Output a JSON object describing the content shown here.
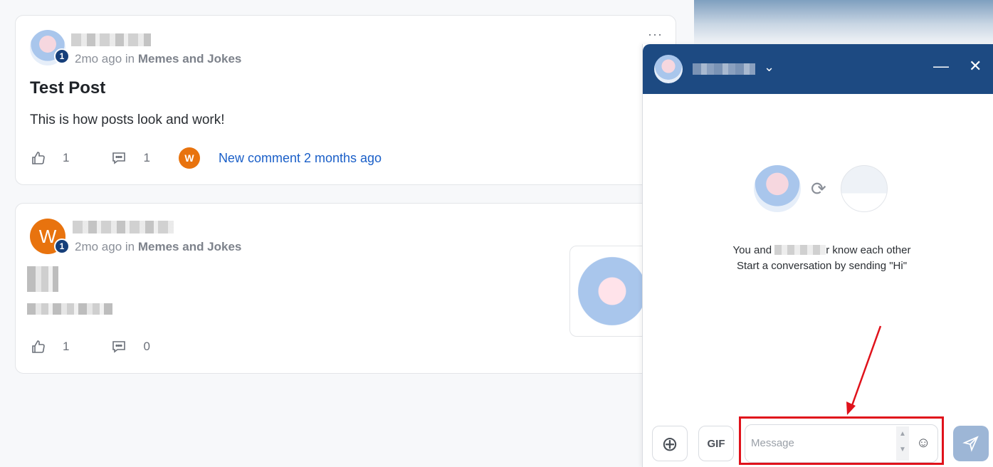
{
  "posts": [
    {
      "level": "1",
      "time": "2mo ago",
      "in_word": "in",
      "group": "Memes and Jokes",
      "title": "Test Post",
      "body": "This is how posts look and work!",
      "likes": "1",
      "comments": "1",
      "commenter_initial": "W",
      "new_comment_text": "New comment 2 months ago",
      "more_label": "···"
    },
    {
      "avatar_initial": "W",
      "level": "1",
      "time": "2mo ago",
      "in_word": "in",
      "group": "Memes and Jokes",
      "likes": "1",
      "comments": "0"
    }
  ],
  "chat": {
    "chevron": "⌄",
    "minimize": "—",
    "close": "✕",
    "intro_prefix": "You and",
    "intro_suffix": "r know each other",
    "intro_line2": "Start a conversation by sending \"Hi\"",
    "plus_label": "⊕",
    "gif_label": "GIF",
    "message_placeholder": "Message",
    "emoji": "☺"
  },
  "colors": {
    "accent": "#1d4a82",
    "link": "#1a5fc8",
    "orange": "#e8730e",
    "highlight": "#e0121b"
  }
}
